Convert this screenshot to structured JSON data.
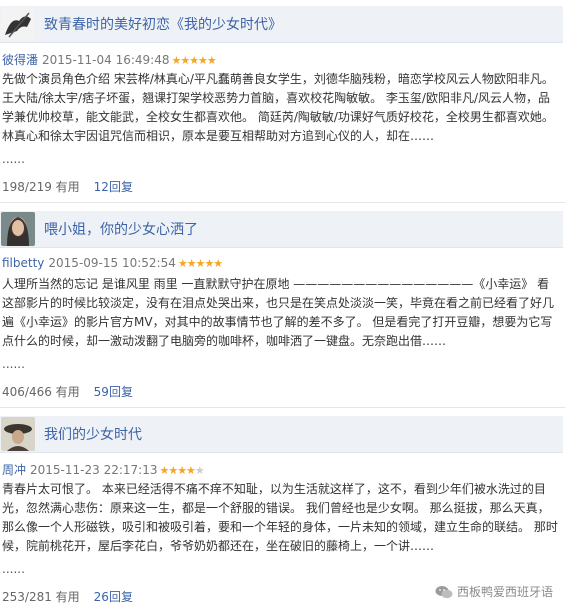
{
  "reviews": [
    {
      "title": "致青春时的美好初恋《我的少女时代》",
      "author": "彼得潘",
      "date": "2015-11-04 16:49:48",
      "stars": 5,
      "text": "先做个演员角色介绍 宋芸桦/林真心/平凡蠢萌善良女学生，刘德华脑残粉，暗恋学校风云人物欧阳非凡。王大陆/徐太宇/痞子坏蛋，翘课打架学校恶势力首脑，喜欢校花陶敏敏。 李玉玺/欧阳非凡/风云人物，品学兼优帅校草，能文能武，全校女生都喜欢他。 简廷芮/陶敏敏/功课好气质好校花，全校男生都喜欢她。 林真心和徐太宇因诅咒信而相识，原本是要互相帮助对方追到心仪的人，却在……",
      "ellipsis": "......",
      "useful": "198/219 有用",
      "replies": "12回复"
    },
    {
      "title": "喂小姐，你的少女心洒了",
      "author": "filbetty",
      "date": "2015-09-15 10:52:54",
      "stars": 5,
      "text": "人理所当然的忘记 是谁风里 雨里 一直默默守护在原地 ———————————————《小幸运》 看这部影片的时候比较淡定，没有在泪点处哭出来，也只是在笑点处淡淡一笑，毕竟在看之前已经看了好几遍《小幸运》的影片官方MV，对其中的故事情节也了解的差不多了。 但是看完了打开豆瓣，想要为它写点什么的时候，却一激动泼翻了电脑旁的咖啡杯，咖啡洒了一键盘。无奈跑出借……",
      "ellipsis": "......",
      "useful": "406/466 有用",
      "replies": "59回复"
    },
    {
      "title": "我们的少女时代",
      "author": "周冲",
      "date": "2015-11-23 22:17:13",
      "stars": 4,
      "text": "青春片太可恨了。 本来已经活得不痛不痒不知耻，以为生活就这样了，这不，看到少年们被水洗过的目光，忽然满心悲伤：原来这一生，都是一个舒服的错误。 我们曾经也是少女啊。 那么挺拔，那么天真，那么像一个人形磁铁，吸引和被吸引着，要和一个年轻的身体，一片未知的领域，建立生命的联结。 那时候，院前桃花开，屋后李花白，爷爷奶奶都还在，坐在破旧的藤椅上，一个讲……",
      "ellipsis": "......",
      "useful": "253/281 有用",
      "replies": "26回复"
    }
  ],
  "watermark": "西板鸭爱西班牙语",
  "colors": {
    "link": "#3d64a8",
    "star": "#f5a623",
    "title_bar": "#eef2f7"
  }
}
